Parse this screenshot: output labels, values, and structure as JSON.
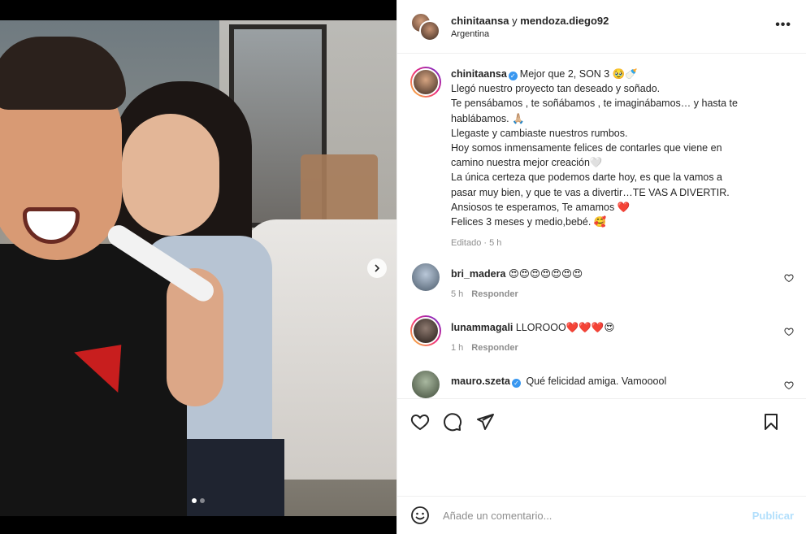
{
  "post": {
    "header": {
      "user1": "chinitaansa",
      "conj": " y ",
      "user2": "mendoza.diego92",
      "location": "Argentina",
      "more_icon": "more-horizontal-icon"
    },
    "caption": {
      "username": "chinitaansa",
      "lines": [
        "Mejor que 2, SON 3 🥹🍼",
        "Llegó nuestro proyecto tan deseado y soñado.",
        "Te pensábamos , te soñábamos , te imaginábamos… y hasta te",
        "hablábamos. 🙏🏼",
        "Llegaste y cambiaste nuestros rumbos.",
        "Hoy somos inmensamente felices de contarles que viene en",
        "camino nuestra mejor creación🤍",
        "La única certeza que podemos darte hoy, es que la vamos a",
        "pasar muy bien, y que te vas a divertir…TE VAS A DIVERTIR.",
        "Ansiosos te esperamos, Te amamos ❤️",
        "Felices 3 meses y medio,bebé. 🥰"
      ],
      "meta": "Editado · 5 h"
    },
    "comments": [
      {
        "username": "bri_madera",
        "text": "😍😍😍😍😍😍😍",
        "time": "5 h",
        "reply": "Responder"
      },
      {
        "username": "lunammagali",
        "text": "LLOROOO❤️❤️❤️😍",
        "time": "1 h",
        "reply": "Responder"
      },
      {
        "username": "mauro.szeta",
        "text": "Qué felicidad amiga. Vamooool",
        "time": "",
        "reply": ""
      }
    ],
    "actions": {
      "like_icon": "heart-outline-icon",
      "comment_icon": "comment-icon",
      "share_icon": "share-icon",
      "save_icon": "bookmark-icon"
    },
    "add_comment": {
      "placeholder": "Añade un comentario...",
      "publish": "Publicar"
    },
    "carousel": {
      "count": 2,
      "active": 0
    }
  }
}
